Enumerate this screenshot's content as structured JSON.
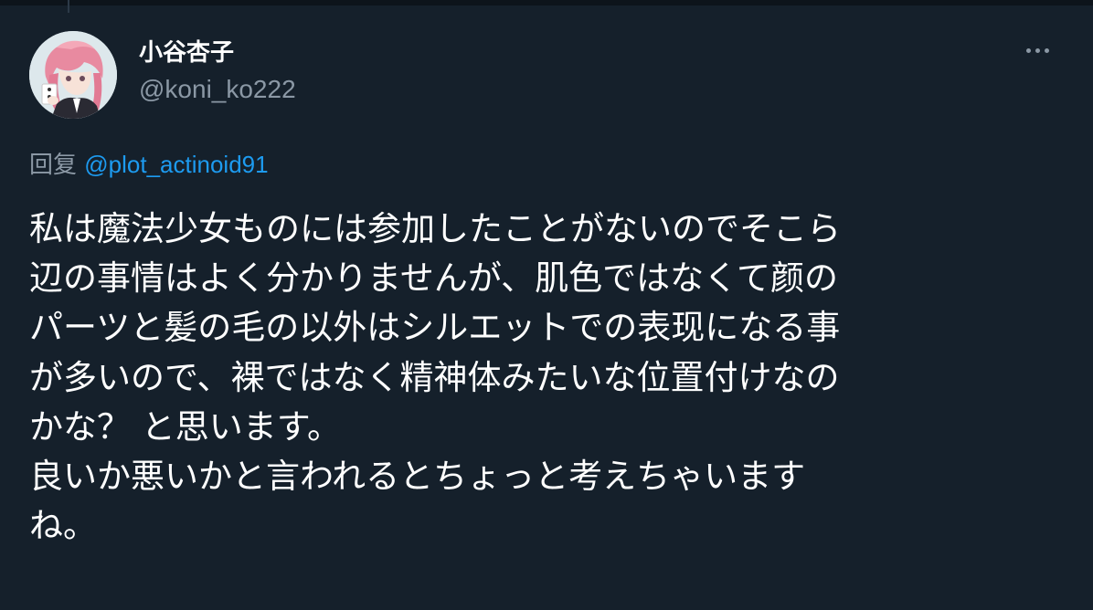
{
  "user": {
    "display_name": "小谷杏子",
    "handle": "@koni_ko222",
    "avatar_icon": "anime-character-avatar-icon"
  },
  "menu": {
    "more_icon": "more-horizontal-icon"
  },
  "reply": {
    "prefix": "回复",
    "to": "@plot_actinoid91"
  },
  "tweet": {
    "lines": [
      "私は魔法少女ものには参加したことがないのでそこら",
      "辺の事情はよく分かりませんが、肌色ではなくて颜の",
      "パーツと髪の毛の以外はシルエットでの表现になる事",
      "が多いので、裸ではなく精神体みたいな位置付けなの",
      "かな？ と思います。",
      "良いか悪いかと言われるとちょっと考えちゃいます",
      "ね。"
    ]
  },
  "colors": {
    "background": "#15202b",
    "text_primary": "#ffffff",
    "text_secondary": "#8b98a5",
    "link": "#1d9bf0"
  }
}
